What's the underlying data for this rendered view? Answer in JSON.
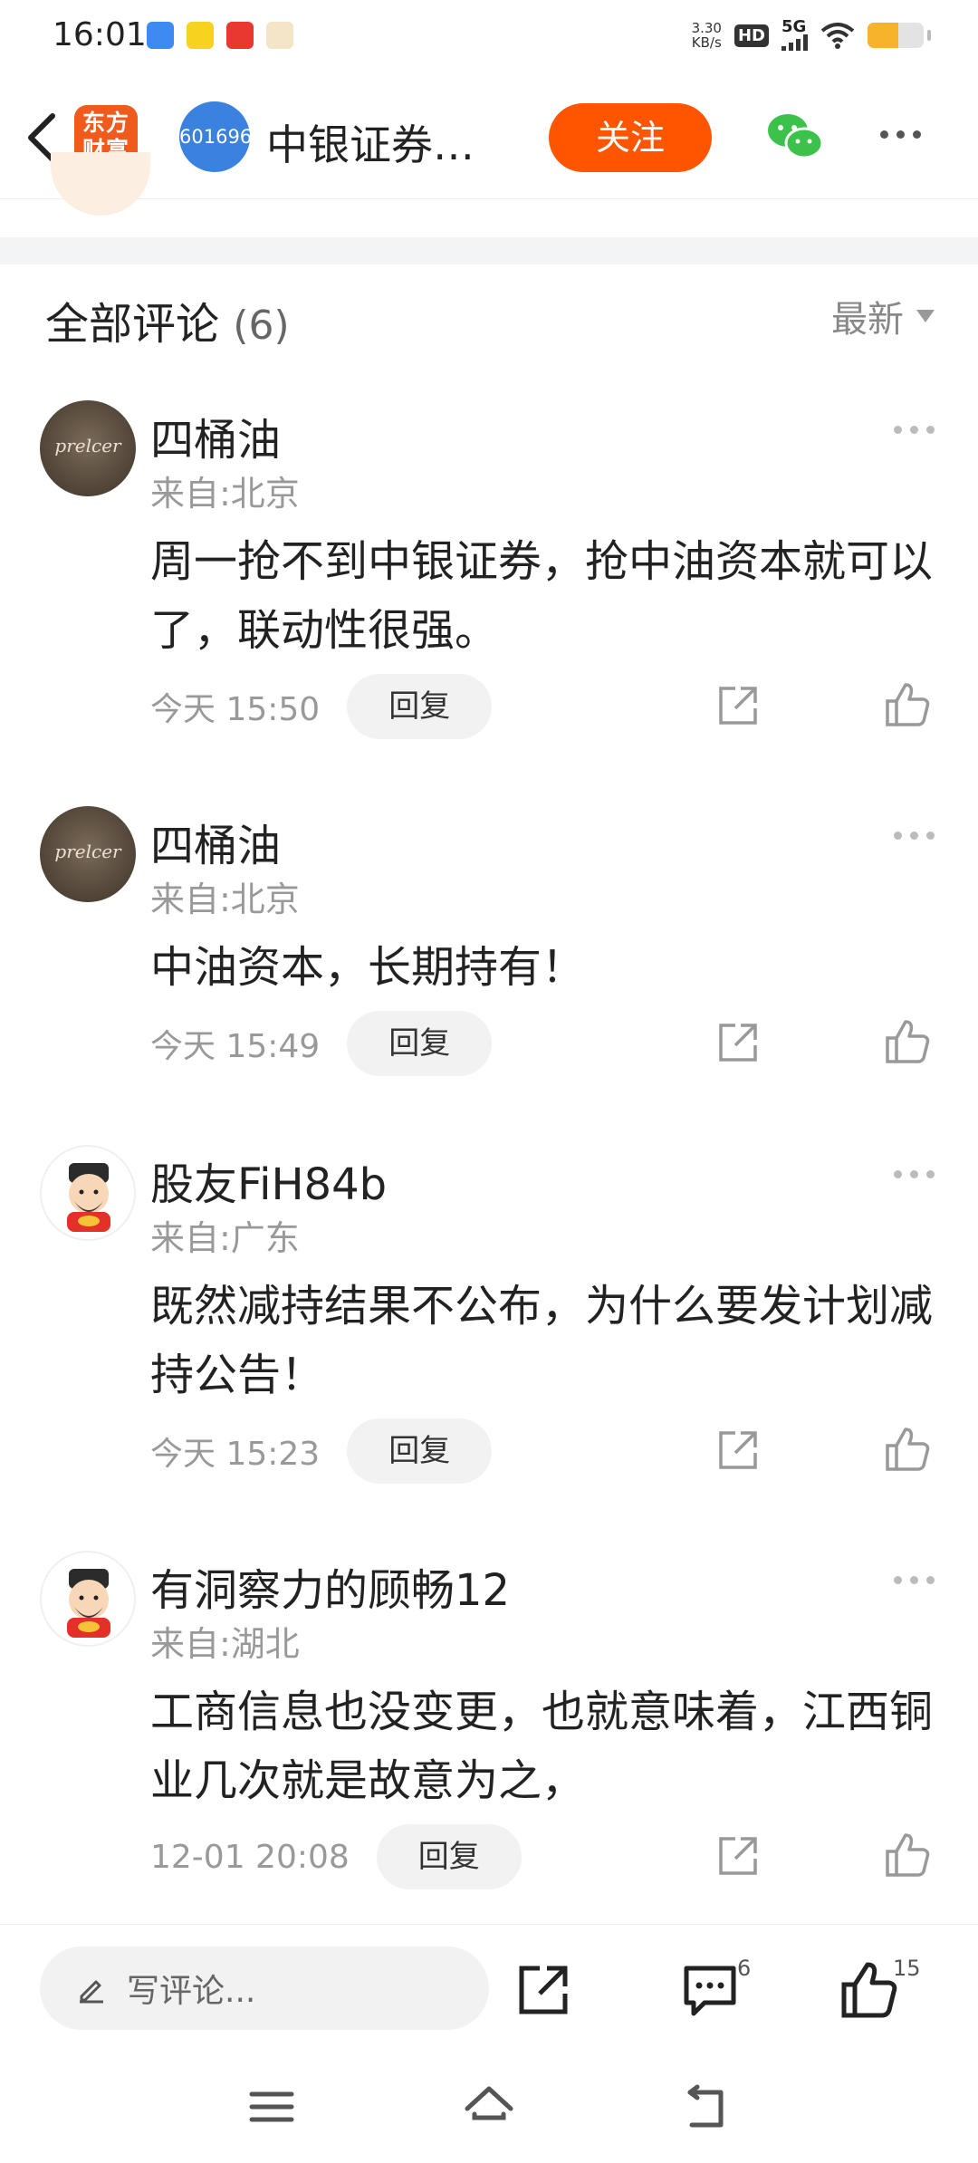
{
  "status_bar": {
    "time": "16:01",
    "net_speed_value": "3.30",
    "net_speed_unit": "KB/s",
    "hd": "HD",
    "network": "5G",
    "battery_level": 0.55
  },
  "header": {
    "app_logo_line1": "东方",
    "app_logo_line2": "财富",
    "stock_code": "601696",
    "stock_title": "中银证券…",
    "follow_label": "关注"
  },
  "comments_header": {
    "title": "全部评论",
    "count": "(6)",
    "sort_label": "最新"
  },
  "comments": [
    {
      "avatar_text": "prelcer",
      "name": "四桶油",
      "location": "来自:北京",
      "text": "周一抢不到中银证券，抢中油资本就可以了，联动性很强。",
      "time": "今天 15:50",
      "reply_label": "回复"
    },
    {
      "avatar_text": "prelcer",
      "name": "四桶油",
      "location": "来自:北京",
      "text": "中油资本，长期持有！",
      "time": "今天 15:49",
      "reply_label": "回复"
    },
    {
      "name": "股友FiH84b",
      "location": "来自:广东",
      "text": "既然减持结果不公布，为什么要发计划减持公告！",
      "time": "今天 15:23",
      "reply_label": "回复"
    },
    {
      "name": "有洞察力的顾畅12",
      "location": "来自:湖北",
      "text": "工商信息也没变更，也就意味着，江西铜业几次就是故意为之，",
      "time": "12-01 20:08",
      "reply_label": "回复"
    }
  ],
  "bottom_bar": {
    "write_placeholder": "写评论...",
    "comment_count": "6",
    "like_count": "15"
  },
  "colors": {
    "accent": "#ff5500",
    "stock_avatar": "#3a82dd",
    "app_logo": "#f05a1c"
  }
}
